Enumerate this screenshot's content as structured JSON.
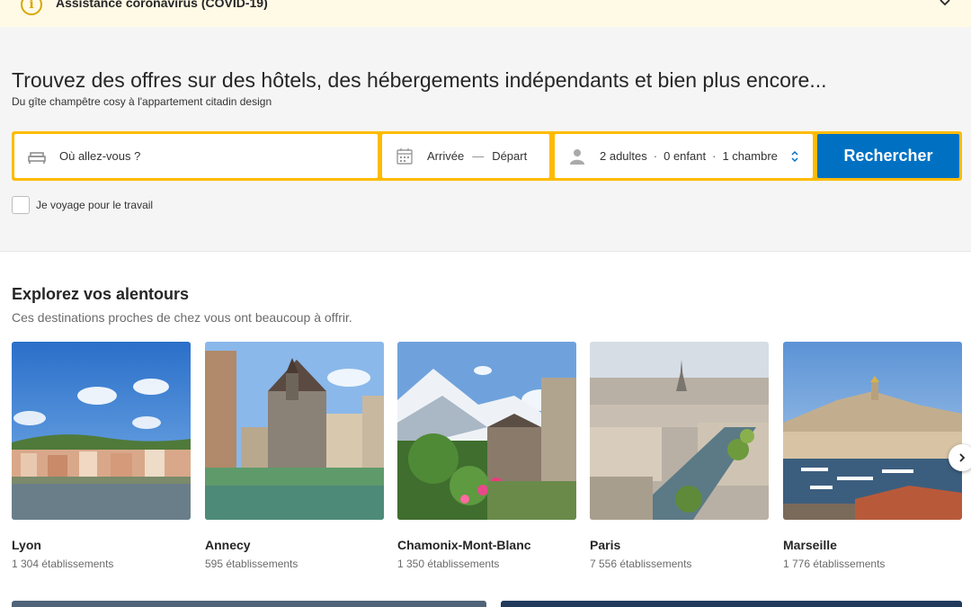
{
  "covid": {
    "title": "Assistance coronavirus (COVID-19)",
    "icon": "info-icon"
  },
  "hero": {
    "title": "Trouvez des offres sur des hôtels, des hébergements indépendants et bien plus encore...",
    "subtitle": "Du gîte champêtre cosy à l'appartement citadin design"
  },
  "search": {
    "destination_placeholder": "Où allez-vous ?",
    "checkin": "Arrivée",
    "dash": "—",
    "checkout": "Départ",
    "adults": "2 adultes",
    "children": "0 enfant",
    "rooms": "1 chambre",
    "separator": "·",
    "button": "Rechercher",
    "accent_color": "#febb02",
    "button_color": "#0071c2"
  },
  "work_travel": {
    "label": "Je voyage pour le travail"
  },
  "explore": {
    "title": "Explorez vos alentours",
    "subtitle": "Ces destinations proches de chez vous ont beaucoup à offrir.",
    "cards": [
      {
        "name": "Lyon",
        "count": "1 304 établissements"
      },
      {
        "name": "Annecy",
        "count": "595 établissements"
      },
      {
        "name": "Chamonix-Mont-Blanc",
        "count": "1 350 établissements"
      },
      {
        "name": "Paris",
        "count": "7 556 établissements"
      },
      {
        "name": "Marseille",
        "count": "1 776 établissements"
      }
    ]
  }
}
